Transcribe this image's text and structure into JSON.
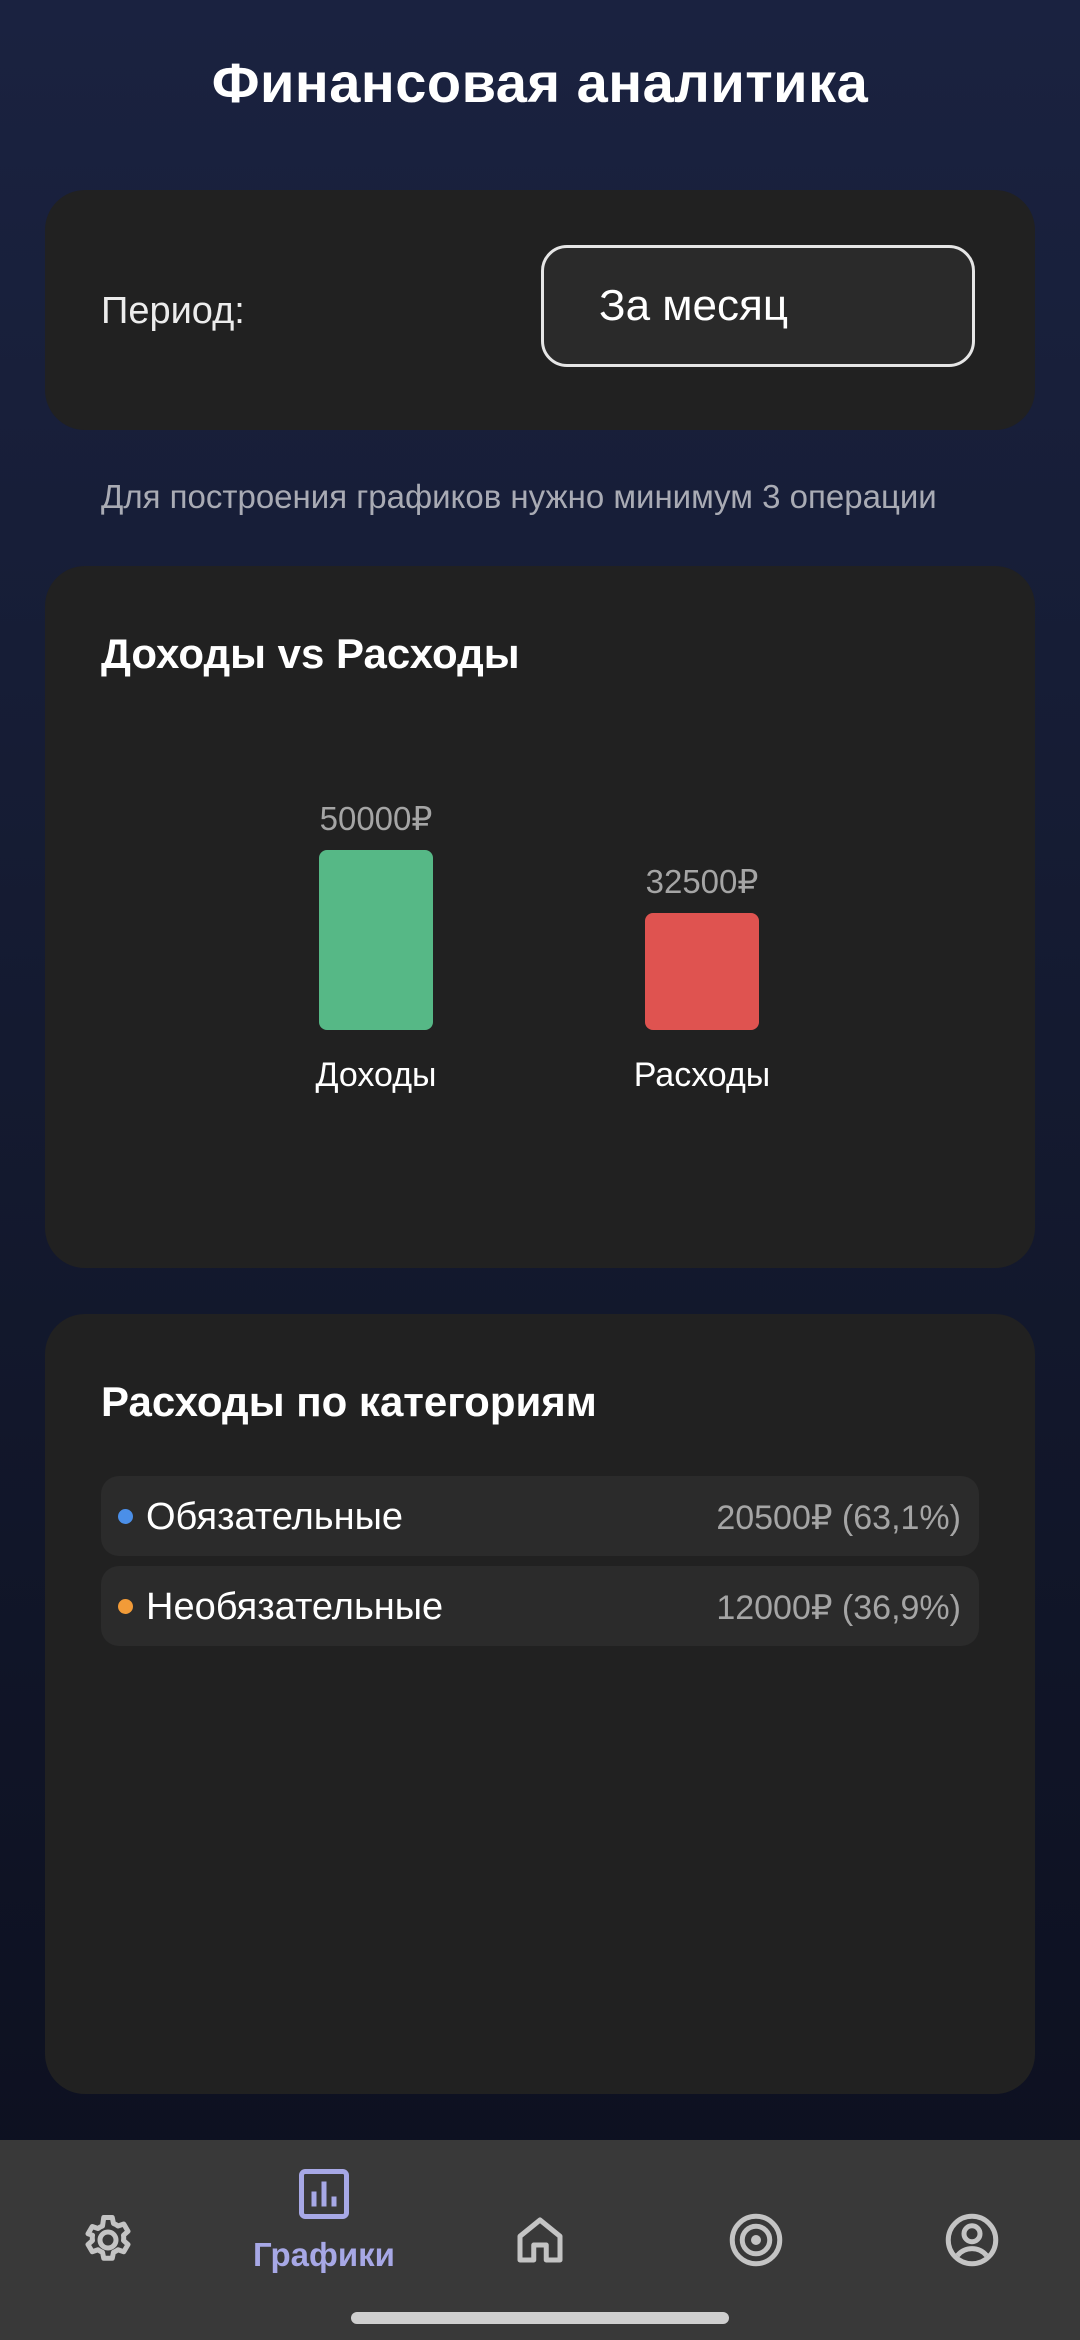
{
  "header": {
    "title": "Финансовая аналитика"
  },
  "period": {
    "label": "Период:",
    "selected": "За месяц"
  },
  "hint": "Для построения графиков нужно минимум 3 операции",
  "income_expense": {
    "title": "Доходы vs Расходы",
    "chart_data": {
      "type": "bar",
      "categories": [
        "Доходы",
        "Расходы"
      ],
      "values": [
        50000,
        32500
      ],
      "value_labels": [
        "50000₽",
        "32500₽"
      ],
      "colors": [
        "#56b886",
        "#df5350"
      ],
      "title": "Доходы vs Расходы"
    }
  },
  "categories": {
    "title": "Расходы по категориям",
    "items": [
      {
        "name": "Обязательные",
        "value": "20500₽ (63,1%)",
        "color": "#4b8fe8"
      },
      {
        "name": "Необязательные",
        "value": "12000₽ (36,9%)",
        "color": "#f29b38"
      }
    ]
  },
  "nav": {
    "items": [
      {
        "icon": "gear-icon",
        "label": "",
        "active": false
      },
      {
        "icon": "bar-chart-icon",
        "label": "Графики",
        "active": true
      },
      {
        "icon": "home-icon",
        "label": "",
        "active": false
      },
      {
        "icon": "target-icon",
        "label": "",
        "active": false
      },
      {
        "icon": "account-icon",
        "label": "",
        "active": false
      }
    ],
    "active_color": "#a7a8e6",
    "inactive_color": "#c4c4c4"
  }
}
